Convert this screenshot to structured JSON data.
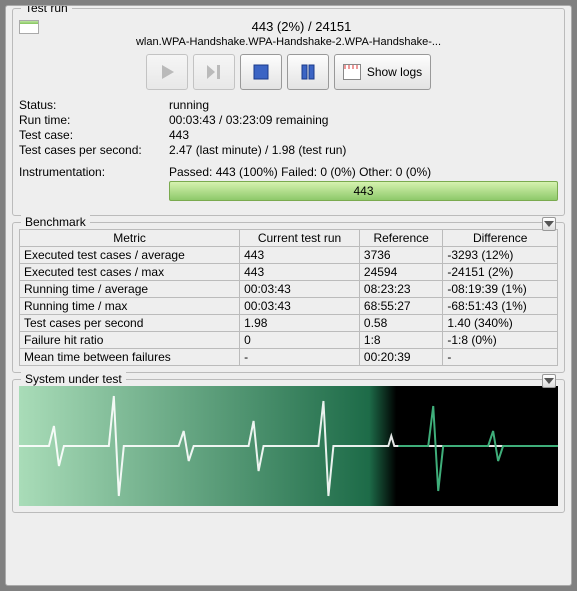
{
  "testrun": {
    "title": "Test run",
    "progress_text": "443 (2%)  /  24151",
    "testcase_path": "wlan.WPA-Handshake.WPA-Handshake-2.WPA-Handshake-...",
    "toolbar": {
      "show_logs": "Show logs"
    },
    "labels": {
      "status": "Status:",
      "runtime": "Run time:",
      "testcase": "Test case:",
      "tcps": "Test cases per second:",
      "instrumentation": "Instrumentation:"
    },
    "values": {
      "status": "running",
      "runtime": "00:03:43 / 03:23:09 remaining",
      "testcase": "443",
      "tcps": "2.47 (last minute) / 1.98 (test run)",
      "instrumentation": "Passed: 443 (100%) Failed: 0 (0%) Other: 0 (0%)",
      "instrumentation_bar": "443"
    }
  },
  "benchmark": {
    "title": "Benchmark",
    "headers": [
      "Metric",
      "Current test run",
      "Reference",
      "Difference"
    ],
    "rows": [
      [
        "Executed test cases / average",
        "443",
        "3736",
        "-3293 (12%)"
      ],
      [
        "Executed test cases / max",
        "443",
        "24594",
        "-24151 (2%)"
      ],
      [
        "Running time / average",
        "00:03:43",
        "08:23:23",
        "-08:19:39 (1%)"
      ],
      [
        "Running time / max",
        "00:03:43",
        "68:55:27",
        "-68:51:43 (1%)"
      ],
      [
        "Test cases per second",
        "1.98",
        "0.58",
        "1.40 (340%)"
      ],
      [
        "Failure hit ratio",
        "0",
        "1:8",
        "-1:8 (0%)"
      ],
      [
        "Mean time between failures",
        "-",
        "00:20:39",
        "-"
      ]
    ]
  },
  "sut": {
    "title": "System under test"
  }
}
